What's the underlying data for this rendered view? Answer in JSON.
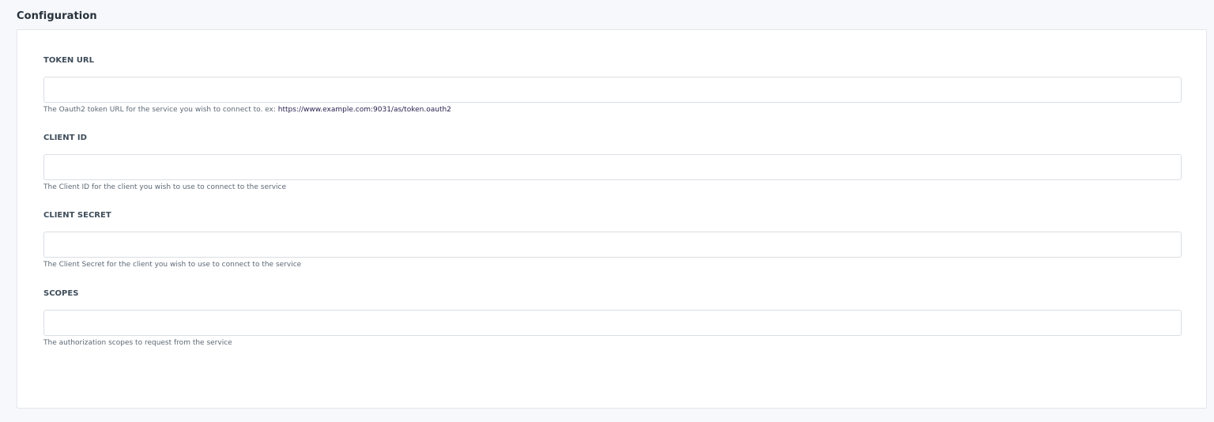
{
  "section": {
    "title": "Configuration"
  },
  "fields": [
    {
      "label": "TOKEN URL",
      "value": "",
      "placeholder": "",
      "help_text": "The Oauth2 token URL for the service you wish to connect to. ex: ",
      "help_link": "https://www.example.com:9031/as/token.oauth2"
    },
    {
      "label": "CLIENT ID",
      "value": "",
      "placeholder": "",
      "help_text": "The Client ID for the client you wish to use to connect to the service"
    },
    {
      "label": "CLIENT SECRET",
      "value": "",
      "placeholder": "",
      "help_text": "The Client Secret for the client you wish to use to connect to the service"
    },
    {
      "label": "SCOPES",
      "value": "",
      "placeholder": "",
      "help_text": "The authorization scopes to request from the service"
    }
  ]
}
